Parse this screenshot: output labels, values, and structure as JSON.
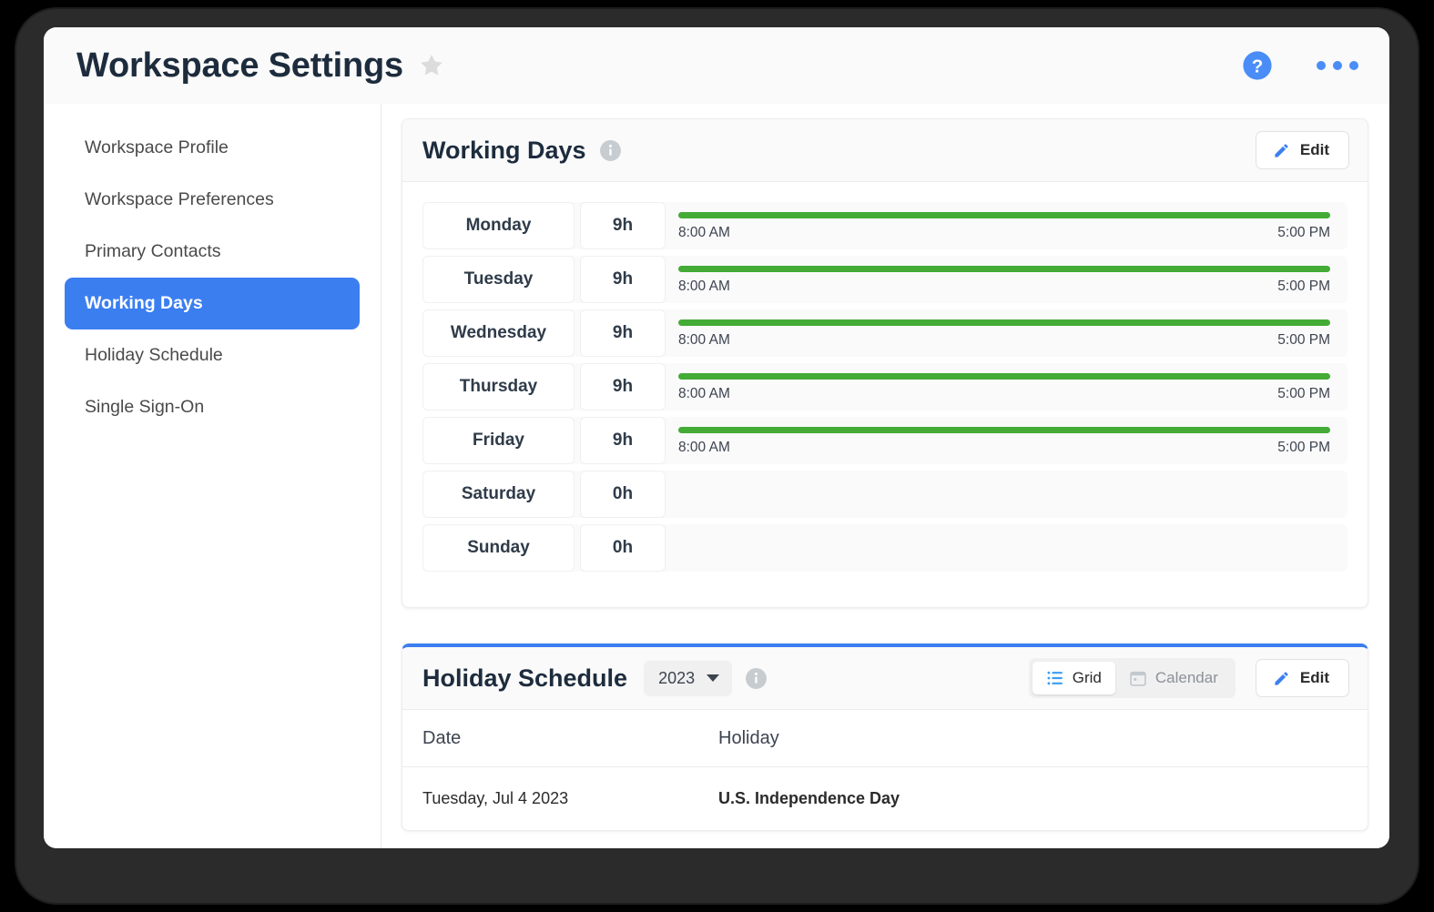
{
  "header": {
    "title": "Workspace Settings",
    "star_icon": "star-icon",
    "help_icon": "help-circle-icon",
    "more_icon": "more-horizontal-icon"
  },
  "sidebar": {
    "items": [
      {
        "label": "Workspace Profile",
        "active": false
      },
      {
        "label": "Workspace Preferences",
        "active": false
      },
      {
        "label": "Primary Contacts",
        "active": false
      },
      {
        "label": "Working Days",
        "active": true
      },
      {
        "label": "Holiday Schedule",
        "active": false
      },
      {
        "label": "Single Sign-On",
        "active": false
      }
    ]
  },
  "working_days": {
    "title": "Working Days",
    "info_icon": "info-icon",
    "edit_label": "Edit",
    "edit_icon": "pencil-icon",
    "bar_color": "#43ab36",
    "rows": [
      {
        "day": "Monday",
        "hours": "9h",
        "start": "8:00 AM",
        "end": "5:00 PM",
        "working": true
      },
      {
        "day": "Tuesday",
        "hours": "9h",
        "start": "8:00 AM",
        "end": "5:00 PM",
        "working": true
      },
      {
        "day": "Wednesday",
        "hours": "9h",
        "start": "8:00 AM",
        "end": "5:00 PM",
        "working": true
      },
      {
        "day": "Thursday",
        "hours": "9h",
        "start": "8:00 AM",
        "end": "5:00 PM",
        "working": true
      },
      {
        "day": "Friday",
        "hours": "9h",
        "start": "8:00 AM",
        "end": "5:00 PM",
        "working": true
      },
      {
        "day": "Saturday",
        "hours": "0h",
        "start": "",
        "end": "",
        "working": false
      },
      {
        "day": "Sunday",
        "hours": "0h",
        "start": "",
        "end": "",
        "working": false
      }
    ]
  },
  "holiday_schedule": {
    "title": "Holiday Schedule",
    "year": "2023",
    "info_icon": "info-icon",
    "accent_color": "#3b7ef0",
    "views": [
      {
        "label": "Grid",
        "icon": "list-grid-icon",
        "active": true
      },
      {
        "label": "Calendar",
        "icon": "calendar-icon",
        "active": false
      }
    ],
    "edit_label": "Edit",
    "edit_icon": "pencil-icon",
    "columns": [
      "Date",
      "Holiday"
    ],
    "rows": [
      {
        "date": "Tuesday, Jul 4 2023",
        "holiday": "U.S. Independence Day"
      }
    ]
  }
}
